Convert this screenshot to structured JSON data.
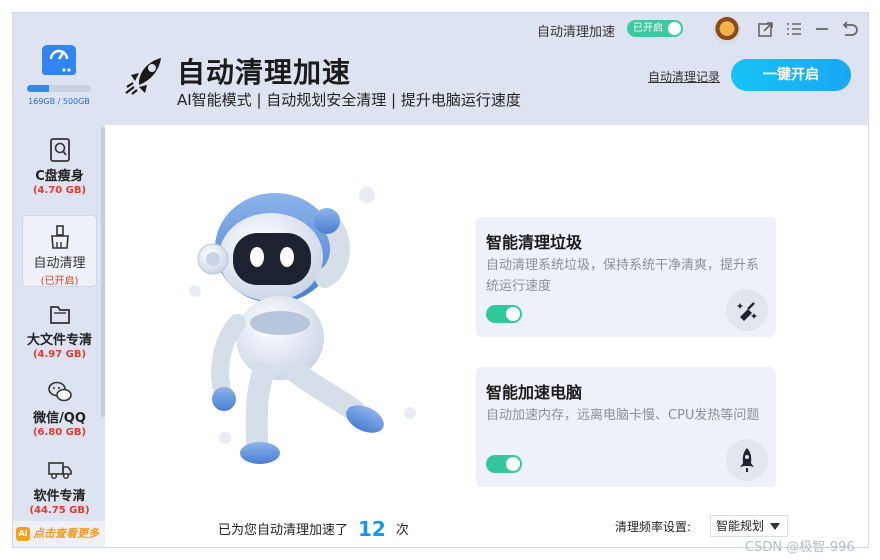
{
  "titlebar": {
    "label": "自动清理加速",
    "badge": "已开启",
    "icons": [
      "avatar",
      "share-icon",
      "menu-icon",
      "minimize-icon",
      "back-icon"
    ]
  },
  "disk": {
    "usage": "169GB / 500GB",
    "used_fraction": 0.338
  },
  "sidebar": {
    "items": [
      {
        "label": "C盘瘦身",
        "sub": "(4.70 GB)",
        "icon": "disk-scan-icon"
      },
      {
        "label": "自动清理",
        "sub": "(已开启)",
        "icon": "broom-icon"
      },
      {
        "label": "大文件专清",
        "sub": "(4.97 GB)",
        "icon": "folder-icon"
      },
      {
        "label": "微信/QQ",
        "sub": "(6.80 GB)",
        "icon": "chat-icon"
      },
      {
        "label": "软件专清",
        "sub": "(44.75 GB)",
        "icon": "truck-icon"
      }
    ],
    "more": "点击查看更多"
  },
  "header": {
    "title": "自动清理加速",
    "subtitle": "AI智能模式 | 自动规划安全清理 | 提升电脑运行速度",
    "record_link": "自动清理记录",
    "start_button": "一键开启"
  },
  "cards": [
    {
      "title": "智能清理垃圾",
      "desc": "自动清理系统垃圾，保持系统干净清爽，提升系统运行速度",
      "enabled": true,
      "icon": "sparkle-broom-icon"
    },
    {
      "title": "智能加速电脑",
      "desc": "自动加速内存，远离电脑卡慢、CPU发热等问题",
      "enabled": true,
      "icon": "rocket-icon"
    }
  ],
  "footer": {
    "prefix": "已为您自动清理加速了",
    "count": "12",
    "suffix": "次",
    "freq_label": "清理频率设置:",
    "freq_value": "智能规划"
  },
  "watermark": "CSDN @极智-996",
  "colors": {
    "accent": "#19a6f2",
    "toggle": "#34c79b",
    "warning": "#e23a2a"
  }
}
